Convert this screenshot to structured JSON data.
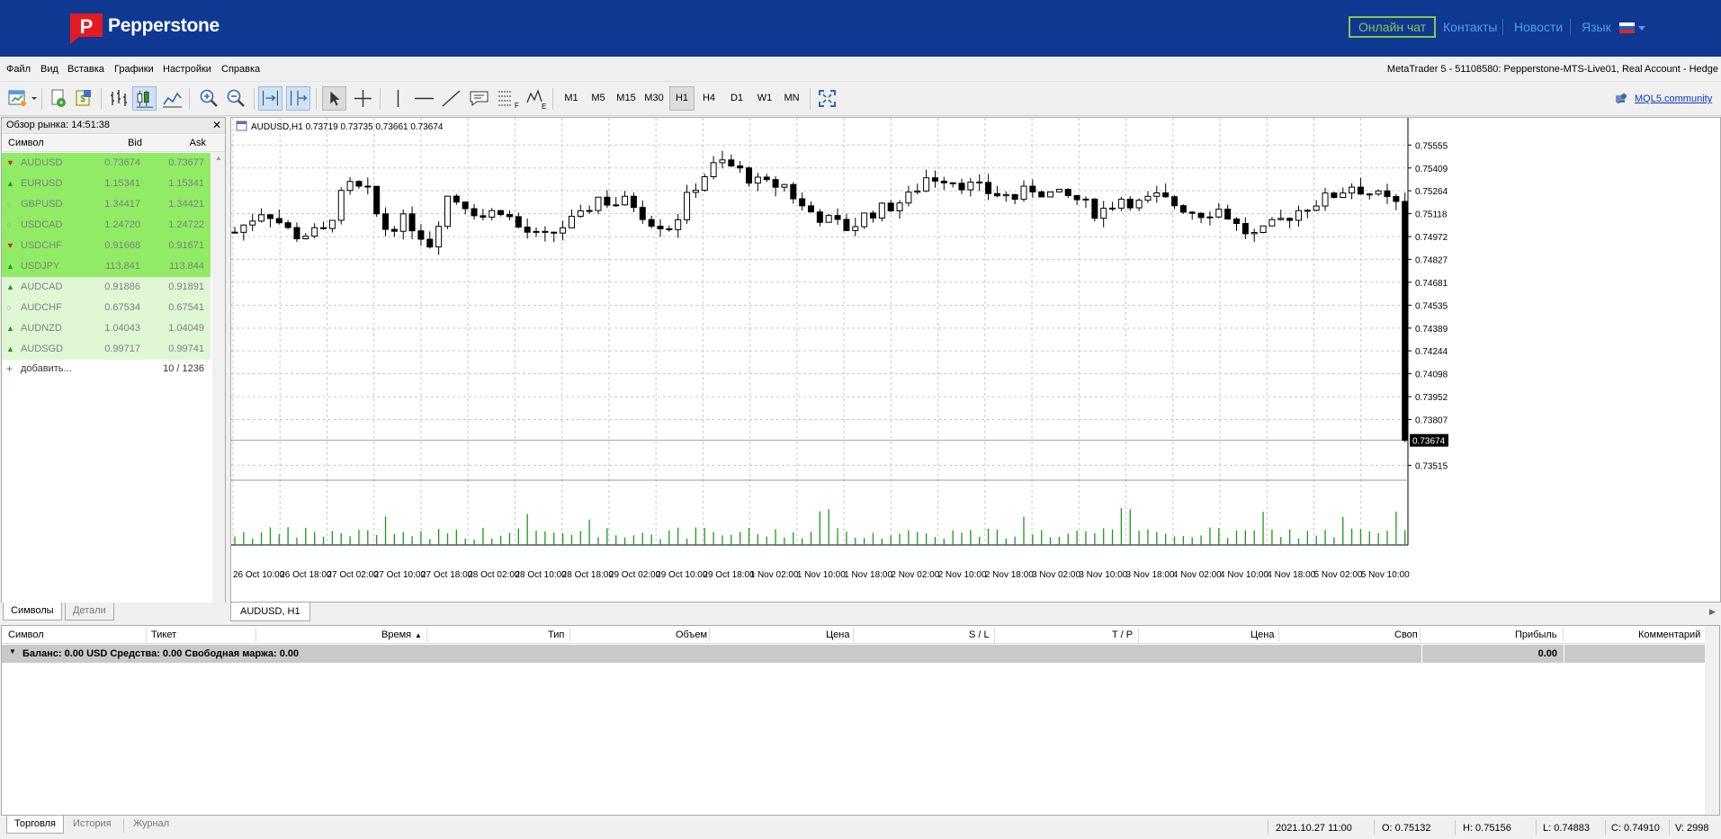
{
  "header": {
    "brand": "Pepperstone",
    "chat": "Онлайн чат",
    "links": [
      "Контакты",
      "Новости",
      "Язык"
    ]
  },
  "menu": {
    "items": [
      "Файл",
      "Вид",
      "Вставка",
      "Графики",
      "Настройки",
      "Справка"
    ],
    "window_title": "MetaTrader 5 - 51108580: Pepperstone-MTS-Live01, Real Account - Hedge"
  },
  "toolbar": {
    "timeframes": [
      "M1",
      "M5",
      "M15",
      "M30",
      "H1",
      "H4",
      "D1",
      "W1",
      "MN"
    ],
    "active_tf": "H1",
    "mql": "MQL5.community"
  },
  "market_watch": {
    "title": "Обзор рынка: 14:51:38",
    "columns": {
      "symbol": "Символ",
      "bid": "Bid",
      "ask": "Ask"
    },
    "rows": [
      {
        "symbol": "AUDUSD",
        "bid": "0.73674",
        "ask": "0.73677",
        "dir": "down",
        "hl": true
      },
      {
        "symbol": "EURUSD",
        "bid": "1.15341",
        "ask": "1.15341",
        "dir": "up",
        "hl": true
      },
      {
        "symbol": "GBPUSD",
        "bid": "1.34417",
        "ask": "1.34421",
        "dir": "none",
        "hl": true
      },
      {
        "symbol": "USDCAD",
        "bid": "1.24720",
        "ask": "1.24722",
        "dir": "none",
        "hl": true
      },
      {
        "symbol": "USDCHF",
        "bid": "0.91668",
        "ask": "0.91671",
        "dir": "down",
        "hl": true
      },
      {
        "symbol": "USDJPY",
        "bid": "113.841",
        "ask": "113.844",
        "dir": "up",
        "hl": true
      },
      {
        "symbol": "AUDCAD",
        "bid": "0.91886",
        "ask": "0.91891",
        "dir": "up",
        "hl": false
      },
      {
        "symbol": "AUDCHF",
        "bid": "0.67534",
        "ask": "0.67541",
        "dir": "none",
        "hl": false
      },
      {
        "symbol": "AUDNZD",
        "bid": "1.04043",
        "ask": "1.04049",
        "dir": "up",
        "hl": false
      },
      {
        "symbol": "AUDSGD",
        "bid": "0.99717",
        "ask": "0.99741",
        "dir": "up",
        "hl": false
      }
    ],
    "add": "добавить...",
    "count": "10 / 1236",
    "tabs": [
      "Символы",
      "Детали"
    ]
  },
  "chart": {
    "info": "AUDUSD,H1  0.73719 0.73735 0.73661 0.73674",
    "tab": "AUDUSD, H1",
    "price_labels": [
      "0.75555",
      "0.75409",
      "0.75264",
      "0.75118",
      "0.74972",
      "0.74827",
      "0.74681",
      "0.74535",
      "0.74389",
      "0.74244",
      "0.74098",
      "0.73952",
      "0.73807",
      "0.73515"
    ],
    "current_price": "0.73674",
    "time_labels": [
      "26 Oct 10:00",
      "26 Oct 18:00",
      "27 Oct 02:00",
      "27 Oct 10:00",
      "27 Oct 18:00",
      "28 Oct 02:00",
      "28 Oct 10:00",
      "28 Oct 18:00",
      "29 Oct 02:00",
      "29 Oct 10:00",
      "29 Oct 18:00",
      "1 Nov 02:00",
      "1 Nov 10:00",
      "1 Nov 18:00",
      "2 Nov 02:00",
      "2 Nov 10:00",
      "2 Nov 18:00",
      "3 Nov 02:00",
      "3 Nov 10:00",
      "3 Nov 18:00",
      "4 Nov 02:00",
      "4 Nov 10:00",
      "4 Nov 18:00",
      "5 Nov 02:00",
      "5 Nov 10:00"
    ],
    "price_path": [
      [
        0,
        0.75
      ],
      [
        10,
        0.7515
      ],
      [
        20,
        0.7498
      ],
      [
        30,
        0.75
      ],
      [
        38,
        0.753
      ],
      [
        45,
        0.7525
      ],
      [
        50,
        0.7502
      ],
      [
        58,
        0.7508
      ],
      [
        66,
        0.7493
      ],
      [
        72,
        0.7523
      ],
      [
        78,
        0.7518
      ],
      [
        84,
        0.751
      ],
      [
        90,
        0.7515
      ],
      [
        96,
        0.7503
      ],
      [
        104,
        0.7495
      ],
      [
        112,
        0.7505
      ],
      [
        118,
        0.751
      ],
      [
        122,
        0.7523
      ],
      [
        128,
        0.7518
      ],
      [
        134,
        0.752
      ],
      [
        140,
        0.7508
      ],
      [
        148,
        0.7503
      ],
      [
        154,
        0.7525
      ],
      [
        158,
        0.7535
      ],
      [
        164,
        0.7545
      ],
      [
        170,
        0.754
      ],
      [
        178,
        0.753
      ],
      [
        186,
        0.753
      ],
      [
        192,
        0.7516
      ],
      [
        200,
        0.7508
      ],
      [
        208,
        0.7502
      ],
      [
        214,
        0.7512
      ],
      [
        220,
        0.7515
      ],
      [
        228,
        0.7522
      ],
      [
        234,
        0.7535
      ],
      [
        240,
        0.7535
      ],
      [
        248,
        0.753
      ],
      [
        256,
        0.7525
      ],
      [
        264,
        0.7522
      ],
      [
        270,
        0.7528
      ],
      [
        278,
        0.7523
      ],
      [
        284,
        0.7522
      ],
      [
        292,
        0.7512
      ],
      [
        300,
        0.7522
      ],
      [
        306,
        0.7518
      ],
      [
        312,
        0.7522
      ],
      [
        318,
        0.7518
      ],
      [
        326,
        0.7512
      ],
      [
        334,
        0.7515
      ],
      [
        340,
        0.7502
      ],
      [
        346,
        0.7497
      ],
      [
        352,
        0.7505
      ],
      [
        358,
        0.7512
      ],
      [
        364,
        0.7518
      ],
      [
        370,
        0.7522
      ],
      [
        378,
        0.753
      ],
      [
        384,
        0.7525
      ],
      [
        390,
        0.752
      ],
      [
        396,
        0.7515
      ]
    ]
  },
  "terminal": {
    "columns": [
      "Символ",
      "Тикет",
      "Время",
      "Тип",
      "Объем",
      "Цена",
      "S / L",
      "T / P",
      "Цена",
      "Своп",
      "Прибыль",
      "Комментарий"
    ],
    "balance": "Баланс: 0.00 USD  Средства: 0.00  Свободная маржа: 0.00",
    "profit": "0.00",
    "tabs": [
      "Торговля",
      "История",
      "Журнал"
    ]
  },
  "status": {
    "time": "2021.10.27 11:00",
    "open": "O: 0.75132",
    "high": "H: 0.75156",
    "low": "L: 0.74883",
    "close": "C: 0.74910",
    "volume": "V: 2998"
  },
  "colors": {
    "brand_bg": "#0f3893",
    "chat_green": "#8bc34a",
    "link_blue": "#4f9fe8",
    "row_hl": "#8fec64",
    "row_hl2": "#dff7d4",
    "up": "#1a9a1a",
    "down": "#d02020",
    "volume": "#1a9a1a"
  }
}
